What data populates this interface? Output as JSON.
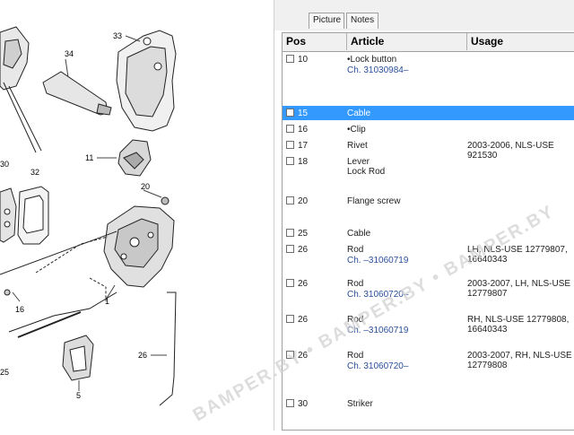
{
  "tabs": [
    "Picture",
    "Notes"
  ],
  "columns": {
    "pos": "Pos",
    "article": "Article",
    "usage": "Usage"
  },
  "rows": [
    {
      "pos": "10",
      "article": "•Lock button",
      "ch": "Ch. 31030984–",
      "usage": "",
      "selected": false
    },
    {
      "pos": "15",
      "article": "Cable",
      "ch": "",
      "usage": "",
      "selected": true
    },
    {
      "pos": "16",
      "article": "•Clip",
      "ch": "",
      "usage": "",
      "selected": false
    },
    {
      "pos": "17",
      "article": "Rivet",
      "ch": "",
      "usage": "2003-2006, NLS-USE 921530",
      "selected": false
    },
    {
      "pos": "18",
      "article": "Lever\nLock  Rod",
      "ch": "",
      "usage": "",
      "selected": false
    },
    {
      "pos": "20",
      "article": "Flange screw",
      "ch": "",
      "usage": "",
      "selected": false
    },
    {
      "pos": "25",
      "article": "Cable",
      "ch": "",
      "usage": "",
      "selected": false
    },
    {
      "pos": "26",
      "article": "Rod",
      "ch": "Ch. –31060719",
      "usage": "LH, NLS-USE 12779807, 16640343",
      "selected": false
    },
    {
      "pos": "26",
      "article": "Rod",
      "ch": "Ch. 31060720–",
      "usage": "2003-2007, LH, NLS-USE 12779807",
      "selected": false
    },
    {
      "pos": "26",
      "article": "Rod",
      "ch": "Ch. –31060719",
      "usage": "RH, NLS-USE 12779808, 16640343",
      "selected": false
    },
    {
      "pos": "26",
      "article": "Rod",
      "ch": "Ch. 31060720–",
      "usage": "2003-2007, RH, NLS-USE 12779808",
      "selected": false
    },
    {
      "pos": "30",
      "article": "Striker",
      "ch": "",
      "usage": "",
      "selected": false
    }
  ],
  "diagram_labels": [
    "33",
    "34",
    "30",
    "32",
    "11",
    "20",
    "16",
    "1",
    "26",
    "25",
    "5"
  ],
  "watermark": "BAMPER.BY • BAMPER.BY • BAMPER.BY",
  "colors": {
    "selection": "#3399ff",
    "header_bg": "#f0f0f0",
    "link_text": "#2a4f9a"
  }
}
